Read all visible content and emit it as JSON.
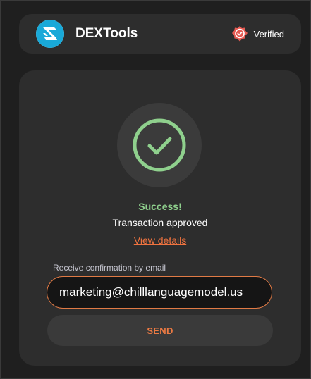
{
  "header": {
    "app_name": "DEXTools",
    "verified_label": "Verified",
    "logo_icon": "dextools-logo-icon",
    "verified_icon": "verified-badge-icon"
  },
  "status": {
    "icon": "checkmark-circle-icon",
    "title": "Success!",
    "subtitle": "Transaction approved",
    "details_link": "View details"
  },
  "email": {
    "label": "Receive confirmation by email",
    "value": "marketing@chilllanguagemodel.us",
    "placeholder": ""
  },
  "actions": {
    "send_label": "SEND"
  },
  "colors": {
    "background": "#1f1f1f",
    "panel": "#2d2d2d",
    "success": "#8fd08d",
    "accent": "#f0733f",
    "logo": "#19a9d8",
    "badge": "#e65b53"
  }
}
